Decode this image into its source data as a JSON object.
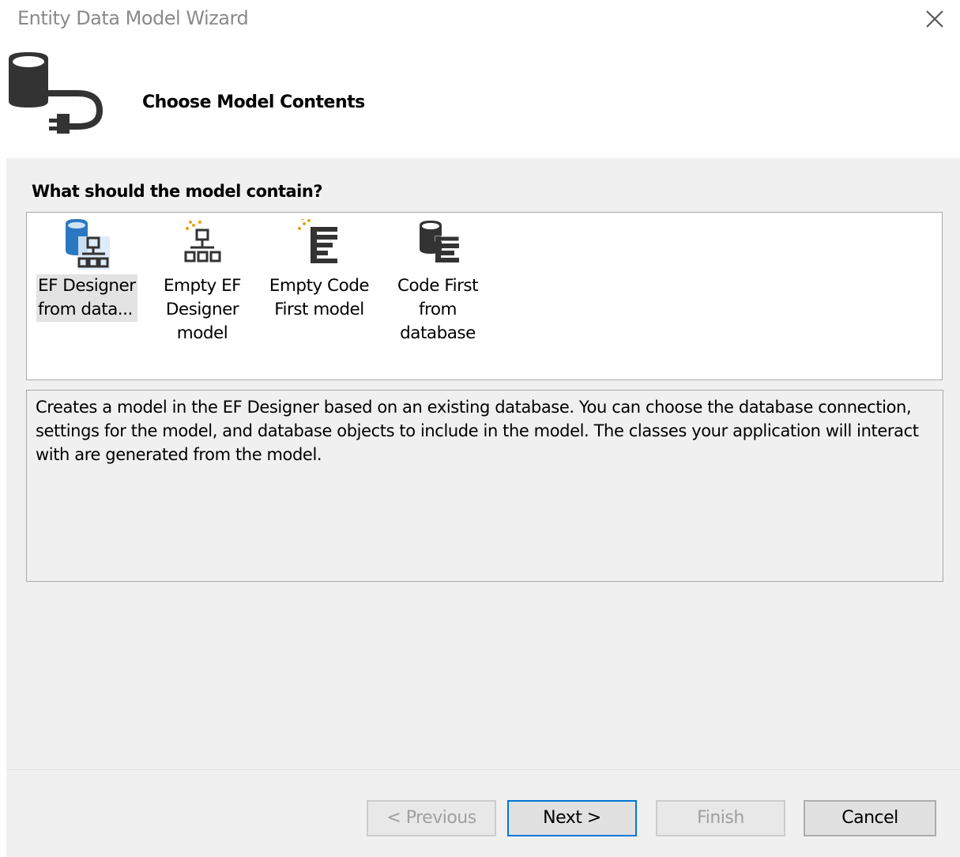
{
  "window": {
    "title": "Entity Data Model Wizard"
  },
  "header": {
    "step_title": "Choose Model Contents",
    "icon": "database-plug-icon"
  },
  "prompt": "What should the model contain?",
  "choices": [
    {
      "line1": "EF Designer",
      "line2": "from data...",
      "line3": "",
      "icon": "ef-designer-database-icon",
      "selected": true
    },
    {
      "line1": "Empty EF",
      "line2": "Designer",
      "line3": "model",
      "icon": "empty-ef-designer-icon",
      "selected": false
    },
    {
      "line1": "Empty Code",
      "line2": "First model",
      "line3": "",
      "icon": "empty-code-first-icon",
      "selected": false
    },
    {
      "line1": "Code First",
      "line2": "from",
      "line3": "database",
      "icon": "code-first-database-icon",
      "selected": false
    }
  ],
  "description": "Creates a model in the EF Designer based on an existing database. You can choose the database connection, settings for the model, and database objects to include in the model. The classes your application will interact with are generated from the model.",
  "buttons": {
    "previous": "< Previous",
    "next": "Next >",
    "finish": "Finish",
    "cancel": "Cancel"
  },
  "colors": {
    "accent": "#0078d7",
    "selection_highlight": "#e3e3e3",
    "panel": "#f0f0f0"
  }
}
